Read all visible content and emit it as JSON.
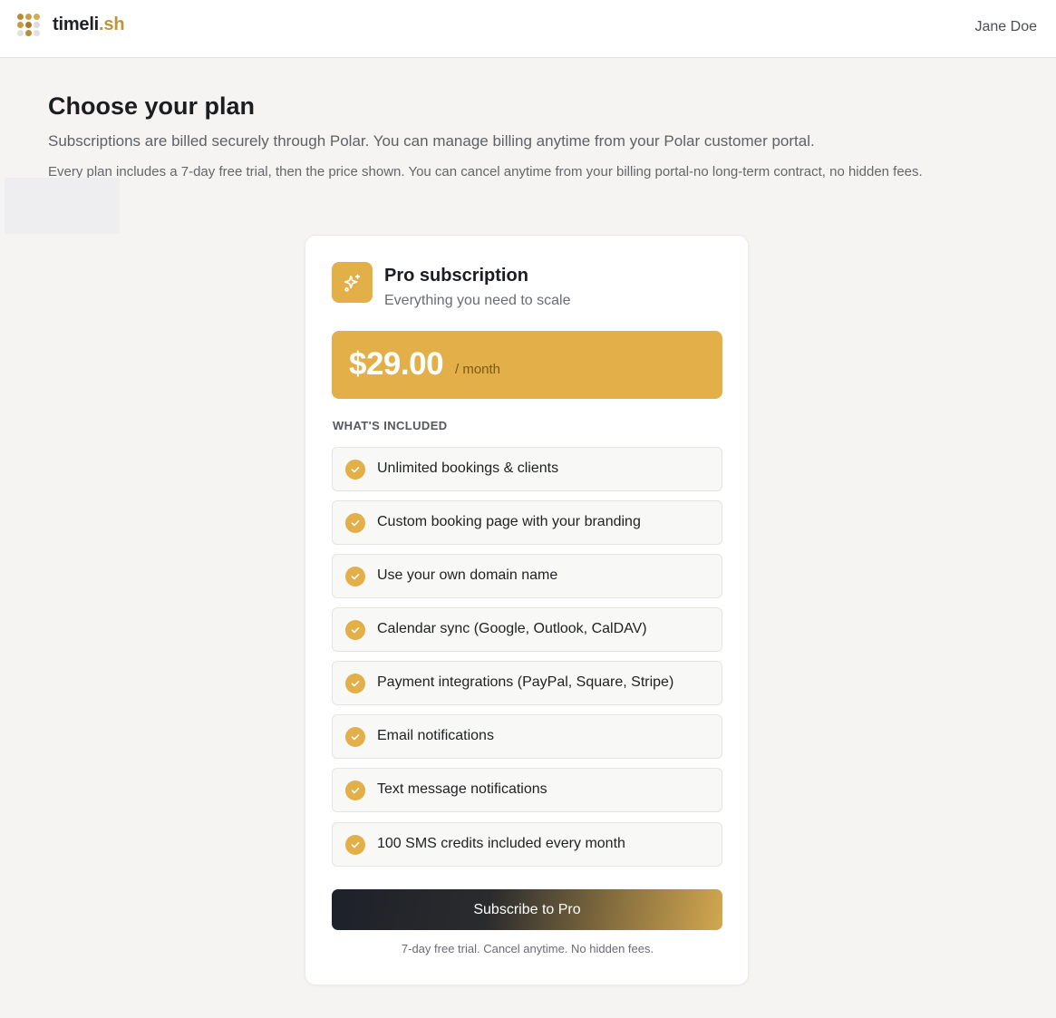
{
  "brand": {
    "name_main": "timeli",
    "name_accent": ".sh",
    "logo_icon": "dot-grid-logo-icon",
    "logo_dot_colors": [
      "#b88d3a",
      "#c9a04a",
      "#d3ab52",
      "#c59b45",
      "#a9792f",
      "#dcdcdc",
      "#e0e0e0",
      "#b88d3a",
      "#e0e0e0"
    ]
  },
  "user": {
    "name": "Jane Doe"
  },
  "header": {
    "title": "Choose your plan",
    "subtitle": "Subscriptions are billed securely through Polar. You can manage billing anytime from your Polar customer portal.",
    "note": "Every plan includes a 7-day free trial, then the price shown. You can cancel anytime from your billing portal-no long-term contract, no hidden fees."
  },
  "plan": {
    "icon": "sparkles-icon",
    "name": "Pro subscription",
    "tagline": "Everything you need to scale",
    "price": "$29.00",
    "period": "/ month",
    "included_label": "WHAT'S INCLUDED",
    "features": [
      "Unlimited bookings & clients",
      "Custom booking page with your branding",
      "Use your own domain name",
      "Calendar sync (Google, Outlook, CalDAV)",
      "Payment integrations (PayPal, Square, Stripe)",
      "Email notifications",
      "Text message notifications",
      "100 SMS credits included every month"
    ],
    "feature_icon": "check-circle-icon",
    "cta_label": "Subscribe to Pro",
    "fine_print": "7-day free trial. Cancel anytime. No hidden fees."
  },
  "colors": {
    "accent": "#e2af48",
    "background": "#f5f4f2",
    "cta_gradient_start": "#1d2129",
    "cta_gradient_end": "#d2a74f"
  }
}
